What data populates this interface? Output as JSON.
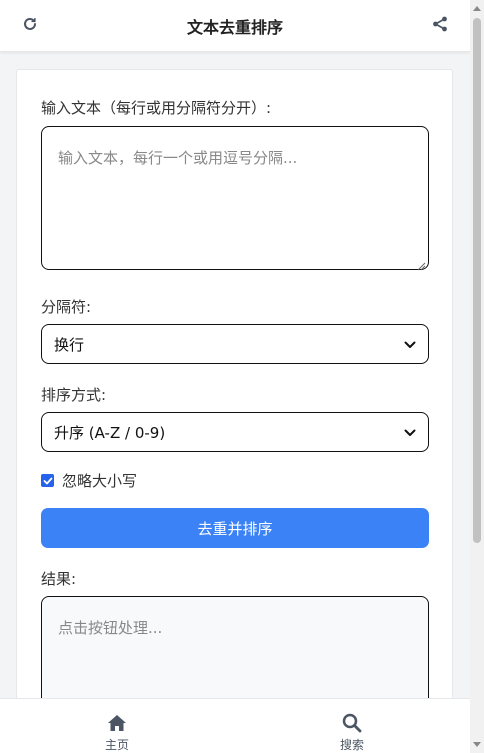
{
  "header": {
    "title": "文本去重排序",
    "left_icon": "refresh-icon",
    "right_icon": "share-icon"
  },
  "form": {
    "input_label": "输入文本（每行或用分隔符分开）:",
    "input_placeholder": "输入文本，每行一个或用逗号分隔...",
    "separator_label": "分隔符:",
    "separator_value": "换行",
    "sort_label": "排序方式:",
    "sort_value": "升序 (A-Z / 0-9)",
    "ignore_case_label": "忽略大小写",
    "ignore_case_checked": true,
    "submit_label": "去重并排序",
    "result_label": "结果:",
    "result_placeholder": "点击按钮处理..."
  },
  "bottom_nav": {
    "items": [
      {
        "label": "主页",
        "icon": "home-icon"
      },
      {
        "label": "搜索",
        "icon": "search-icon"
      }
    ]
  },
  "colors": {
    "primary": "#3b82f6",
    "checkbox": "#2563eb"
  }
}
